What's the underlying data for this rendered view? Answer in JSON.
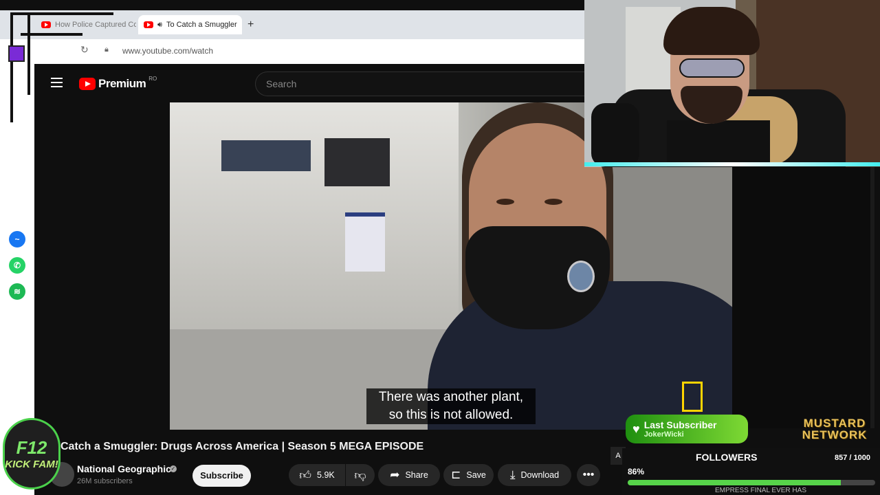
{
  "browser": {
    "tabs": [
      {
        "label": "How Police Captured Col",
        "active": false
      },
      {
        "label": "To Catch a Smuggler",
        "active": true
      }
    ],
    "new_tab": "+",
    "url": "www.youtube.com/watch"
  },
  "youtube": {
    "logo": "Premium",
    "region": "RO",
    "search_placeholder": "Search",
    "video_caption_line1": "There was another plant,",
    "video_caption_line2": "so this is not allowed.",
    "title": "Catch a Smuggler: Drugs Across America | Season 5 MEGA EPISODE",
    "channel": "National Geographic",
    "subscribers": "26M subscribers",
    "subscribe_label": "Subscribe",
    "like_count": "5.9K",
    "share_label": "Share",
    "save_label": "Save",
    "download_label": "Download",
    "peek_label": "A"
  },
  "overlay": {
    "badge_line1": "F12",
    "badge_line2": "KICK FAM!",
    "last_subscriber_label": "Last Subscriber",
    "last_subscriber_name": "JokerWicki",
    "network_line1": "MUSTARD",
    "network_line2": "NETWORK",
    "followers_title": "FOLLOWERS",
    "followers_count": "857 / 1000",
    "followers_percent_label": "86%",
    "followers_fraction": 0.86,
    "bottom_strip_text": "EMPRESS FINAL EVER HAS"
  },
  "icons": {
    "sidebar": [
      "messenger-icon",
      "whatsapp-icon",
      "spotify-icon"
    ]
  },
  "colors": {
    "youtube_red": "#ff0000",
    "follower_bar": "#57d34a",
    "subscriber_green": "#7ed934"
  }
}
